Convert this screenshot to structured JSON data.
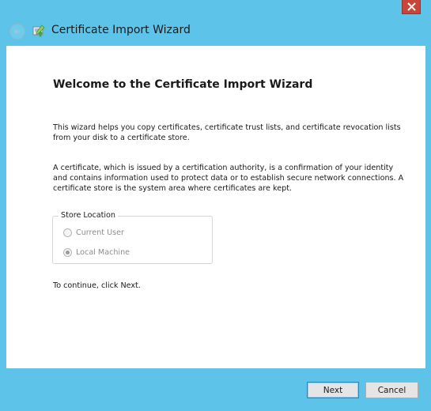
{
  "window": {
    "title": "Certificate Import Wizard"
  },
  "icons": {
    "back": "back-arrow-icon",
    "wizard": "certificate-wizard-icon",
    "close": "close-icon"
  },
  "colors": {
    "title_bar": "#5ec3e8",
    "close_button": "#c7463a",
    "content_bg": "#ffffff"
  },
  "page": {
    "heading": "Welcome to the Certificate Import Wizard",
    "intro_text": "This wizard helps you copy certificates, certificate trust lists, and certificate revocation lists from your disk to a certificate store.",
    "description_text": "A certificate, which is issued by a certification authority, is a confirmation of your identity and contains information used to protect data or to establish secure network connections. A certificate store is the system area where certificates are kept.",
    "store_location": {
      "legend": "Store Location",
      "options": [
        {
          "label": "Current User",
          "selected": false,
          "enabled": false
        },
        {
          "label": "Local Machine",
          "selected": true,
          "enabled": false
        }
      ]
    },
    "continue_text": "To continue, click Next."
  },
  "footer": {
    "next_label": "Next",
    "cancel_label": "Cancel"
  }
}
